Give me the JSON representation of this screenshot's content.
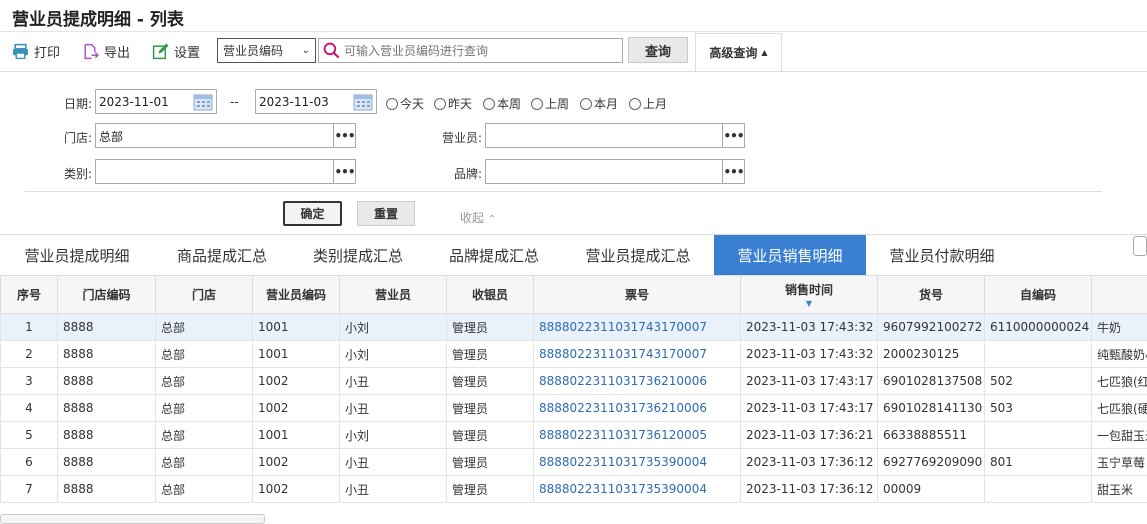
{
  "page": {
    "title": "营业员提成明细 - 列表"
  },
  "toolbar": {
    "print_label": "打印",
    "export_label": "导出",
    "settings_label": "设置",
    "search_field": "营业员编码",
    "search_placeholder": "可输入营业员编码进行查询",
    "query_label": "查询",
    "advanced_label": "高级查询"
  },
  "filters": {
    "date_label": "日期:",
    "date_from": "2023-11-01",
    "date_sep": "--",
    "date_to": "2023-11-03",
    "quick_ranges": [
      "今天",
      "昨天",
      "本周",
      "上周",
      "本月",
      "上月"
    ],
    "store_label": "门店:",
    "store_value": "总部",
    "salesperson_label": "营业员:",
    "salesperson_value": "",
    "category_label": "类别:",
    "category_value": "",
    "brand_label": "品牌:",
    "brand_value": "",
    "ok_label": "确定",
    "reset_label": "重置",
    "collapse_label": "收起"
  },
  "tabs": [
    {
      "label": "营业员提成明细",
      "active": false
    },
    {
      "label": "商品提成汇总",
      "active": false
    },
    {
      "label": "类别提成汇总",
      "active": false
    },
    {
      "label": "品牌提成汇总",
      "active": false
    },
    {
      "label": "营业员提成汇总",
      "active": false
    },
    {
      "label": "营业员销售明细",
      "active": true
    },
    {
      "label": "营业员付款明细",
      "active": false
    }
  ],
  "table": {
    "columns": [
      "序号",
      "门店编码",
      "门店",
      "营业员编码",
      "营业员",
      "收银员",
      "票号",
      "销售时间",
      "货号",
      "自编码",
      ""
    ],
    "rows": [
      [
        "1",
        "8888",
        "总部",
        "1001",
        "小刘",
        "管理员",
        "888802231103174317000​7",
        "2023-11-03 17:43:32",
        "9607992100272",
        "6110000000024",
        "牛奶"
      ],
      [
        "2",
        "8888",
        "总部",
        "1001",
        "小刘",
        "管理员",
        "8888022311031743170007",
        "2023-11-03 17:43:32",
        "2000230125",
        "",
        "纯甄酸奶小"
      ],
      [
        "3",
        "8888",
        "总部",
        "1002",
        "小丑",
        "管理员",
        "8888022311031736210006",
        "2023-11-03 17:43:17",
        "6901028137508",
        "502",
        "七匹狼(红"
      ],
      [
        "4",
        "8888",
        "总部",
        "1002",
        "小丑",
        "管理员",
        "8888022311031736210006",
        "2023-11-03 17:43:17",
        "6901028141130",
        "503",
        "七匹狼(硬"
      ],
      [
        "5",
        "8888",
        "总部",
        "1001",
        "小刘",
        "管理员",
        "8888022311031736120005",
        "2023-11-03 17:36:21",
        "66338885511",
        "",
        "一包甜玉米"
      ],
      [
        "6",
        "8888",
        "总部",
        "1002",
        "小丑",
        "管理员",
        "8888022311031735390004",
        "2023-11-03 17:36:12",
        "6927769209090",
        "801",
        "玉宁草莓"
      ],
      [
        "7",
        "8888",
        "总部",
        "1002",
        "小丑",
        "管理员",
        "8888022311031735390004",
        "2023-11-03 17:36:12",
        "00009",
        "",
        "甜玉米"
      ]
    ]
  }
}
